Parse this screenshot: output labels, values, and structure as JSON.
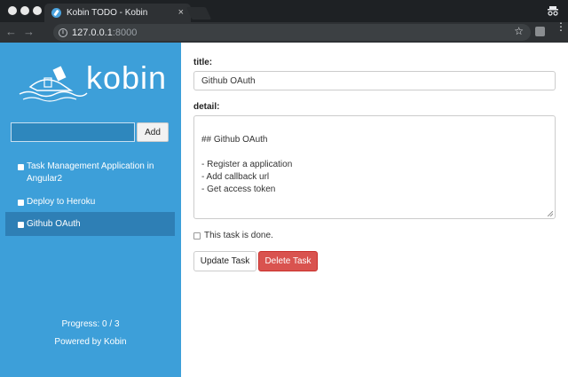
{
  "browser": {
    "tab_title": "Kobin TODO - Kobin",
    "tab_close": "×",
    "url_host": "127.0.0.1",
    "url_port": ":8000",
    "back": "←",
    "forward": "→",
    "star": "☆",
    "menu": "⋮"
  },
  "sidebar": {
    "logo_text": "kobin",
    "new_task_placeholder": "",
    "add_label": "Add",
    "tasks": [
      {
        "label": "Task Management Application in Angular2",
        "active": false
      },
      {
        "label": "Deploy to Heroku",
        "active": false
      },
      {
        "label": "Github OAuth",
        "active": true
      }
    ],
    "progress": "Progress: 0 / 3",
    "powered": "Powered by Kobin"
  },
  "main": {
    "title_label": "title:",
    "title_value": "Github OAuth",
    "detail_label": "detail:",
    "detail_value": "## Github OAuth\n\n- Register a application\n- Add callback url\n- Get access token",
    "done_label": "This task is done.",
    "update_label": "Update Task",
    "delete_label": "Delete Task"
  },
  "colors": {
    "sidebar_bg": "#3d9fd9",
    "active_task_bg": "#2e7fb5",
    "delete_bg": "#d9534f"
  }
}
